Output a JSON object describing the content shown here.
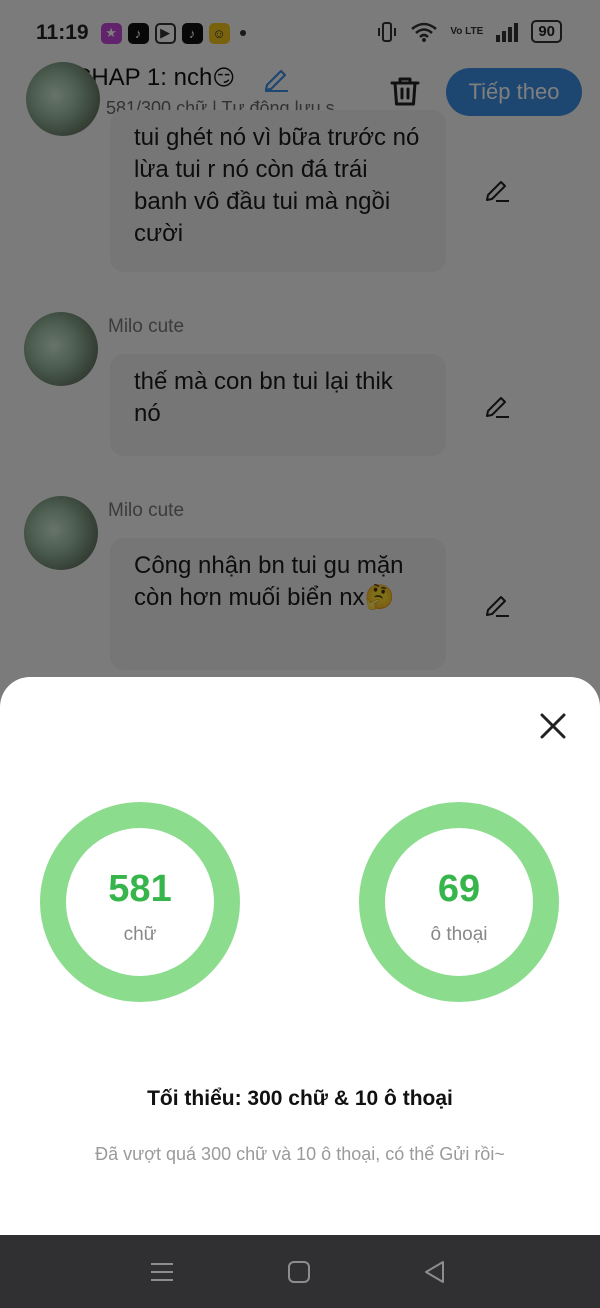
{
  "status_bar": {
    "time": "11:19",
    "battery": "90",
    "volte": "Vo LTE"
  },
  "header": {
    "title": "CHAP 1: nch",
    "title_emoji": "😏",
    "word_status": "581/300 chữ | Tự động lưu s",
    "next_label": "Tiếp theo"
  },
  "messages": [
    {
      "sender": "",
      "text": "tui ghét nó vì bữa trước nó lừa tui r nó còn đá trái banh vô đầu tui mà ngồi cười"
    },
    {
      "sender": "Milo cute",
      "text": "thế mà con bn tui lại thik nó"
    },
    {
      "sender": "Milo cute",
      "text": "Công nhận bn tui gu mặn còn hơn muối biển nx🤔"
    }
  ],
  "sheet": {
    "words_count": "581",
    "words_label": "chữ",
    "dialogue_count": "69",
    "dialogue_label": "ô thoại",
    "minimum": "Tối thiểu: 300 chữ & 10 ô thoại",
    "hint": "Đã vượt quá 300 chữ và 10 ô thoại, có thể Gửi rồi~"
  },
  "colors": {
    "accent_blue": "#3b8de0",
    "ring_green": "#8cdc8e",
    "count_green": "#36b54a",
    "nav_bg": "#303033"
  }
}
